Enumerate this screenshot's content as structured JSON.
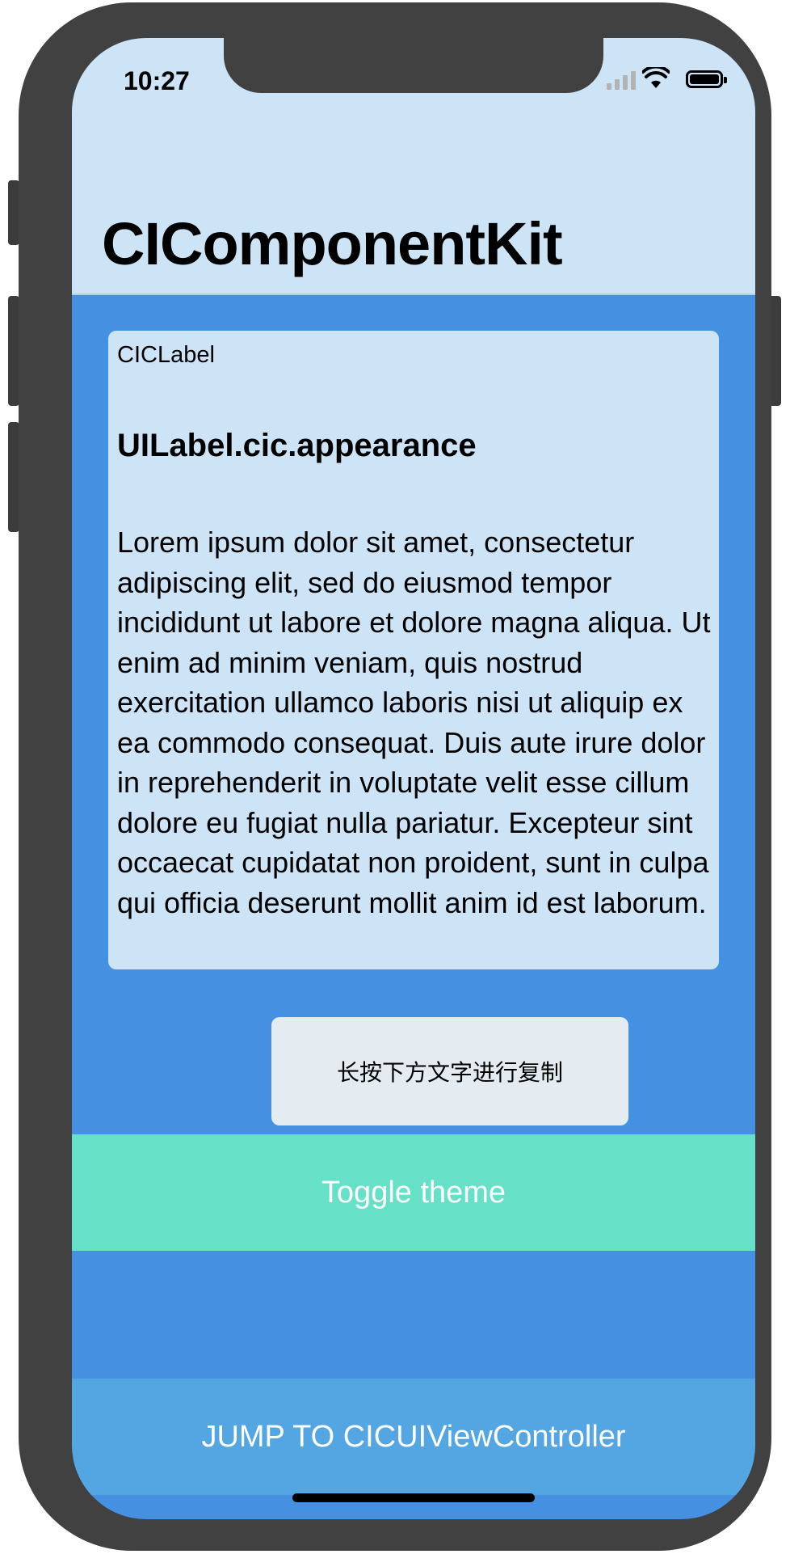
{
  "status_bar": {
    "time": "10:27",
    "icons": [
      "cellular-signal-icon",
      "wifi-icon",
      "battery-icon"
    ]
  },
  "nav": {
    "title": "CIComponentKit"
  },
  "card": {
    "caption": "CICLabel",
    "heading": "UILabel.cic.appearance",
    "body": "Lorem ipsum dolor sit amet, consectetur adipiscing elit, sed do eiusmod tempor incididunt ut labore et dolore magna aliqua. Ut enim ad minim veniam, quis nostrud exercitation ullamco laboris nisi ut aliquip ex ea commodo consequat. Duis aute irure dolor in reprehenderit in voluptate velit esse cillum dolore eu fugiat nulla pariatur. Excepteur sint occaecat cupidatat non proident, sunt in culpa qui officia deserunt mollit anim id est laborum."
  },
  "toast": {
    "message": "长按下方文字进行复制"
  },
  "buttons": {
    "toggle_theme": "Toggle theme",
    "jump": "JUMP TO CICUIViewController"
  },
  "colors": {
    "background": "#4690e2",
    "nav_background": "#cde3f6",
    "card_background": "#cde3f6",
    "toggle_button": "#67e0c8",
    "jump_button": "#54a6e3",
    "toast_background": "#e4ecf2"
  }
}
